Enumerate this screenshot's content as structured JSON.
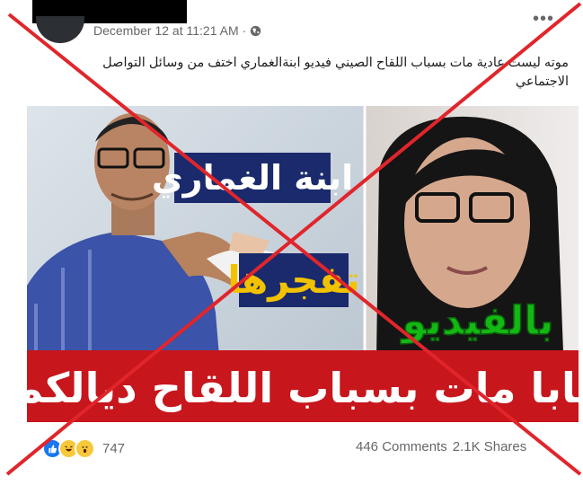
{
  "post": {
    "timestamp": "December 12 at 11:21 AM",
    "visibility_icon": "globe-icon",
    "more_icon": "more-options-icon",
    "caption": "موته ليست عادية مات بسباب اللقاح الصيني فيديو ابنةالغماري اختف من وسائل التواصل الاجتماعي"
  },
  "thumbnail": {
    "label_name": "ابنة الغماري",
    "label_exploded": "تفجرها",
    "label_video": "بالفيديو",
    "banner": "بابا مات بسباب اللقاح ديالكم"
  },
  "footer": {
    "reactions": [
      "like-icon",
      "haha-icon",
      "wow-icon"
    ],
    "reaction_count": "747",
    "comments": "446 Comments",
    "shares": "2.1K Shares"
  },
  "colors": {
    "cross": "#e0252b",
    "banner_red": "#c7161c",
    "label_green": "#14b814",
    "label_navy": "#1a2a6c"
  }
}
